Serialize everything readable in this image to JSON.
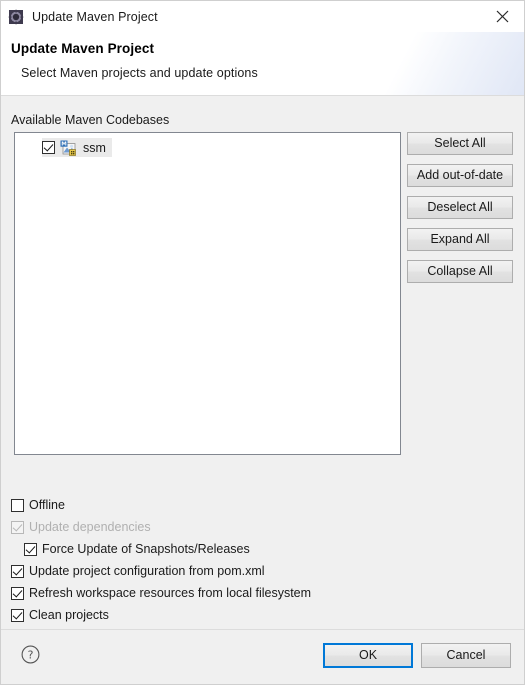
{
  "window": {
    "title": "Update Maven Project",
    "icon": "maven-gear-icon",
    "close_label": "✕"
  },
  "banner": {
    "title": "Update Maven Project",
    "subtitle": "Select Maven projects and update options"
  },
  "main": {
    "section_label": "Available Maven Codebases",
    "tree": {
      "items": [
        {
          "label": "ssm",
          "checked": true,
          "selected": true,
          "icon": "maven-project-icon"
        }
      ]
    },
    "side_buttons": [
      {
        "label": "Select All",
        "name": "select-all-button"
      },
      {
        "label": "Add out-of-date",
        "name": "add-out-of-date-button"
      },
      {
        "label": "Deselect All",
        "name": "deselect-all-button"
      },
      {
        "label": "Expand All",
        "name": "expand-all-button"
      },
      {
        "label": "Collapse All",
        "name": "collapse-all-button"
      }
    ],
    "options": [
      {
        "label": "Offline",
        "checked": false,
        "disabled": false,
        "indent": false,
        "name": "offline-checkbox"
      },
      {
        "label": "Update dependencies",
        "checked": true,
        "disabled": true,
        "indent": false,
        "name": "update-dependencies-checkbox"
      },
      {
        "label": "Force Update of Snapshots/Releases",
        "checked": true,
        "disabled": false,
        "indent": true,
        "name": "force-update-snapshots-checkbox"
      },
      {
        "label": "Update project configuration from pom.xml",
        "checked": true,
        "disabled": false,
        "indent": false,
        "name": "update-project-configuration-checkbox"
      },
      {
        "label": "Refresh workspace resources from local filesystem",
        "checked": true,
        "disabled": false,
        "indent": false,
        "name": "refresh-workspace-resources-checkbox"
      },
      {
        "label": "Clean projects",
        "checked": true,
        "disabled": false,
        "indent": false,
        "name": "clean-projects-checkbox"
      }
    ]
  },
  "footer": {
    "help_icon": "help-question-icon",
    "ok_label": "OK",
    "cancel_label": "Cancel"
  },
  "colors": {
    "focus_blue": "#0078d7",
    "dialog_background": "#f0f0f0",
    "panel_background": "#ffffff"
  }
}
